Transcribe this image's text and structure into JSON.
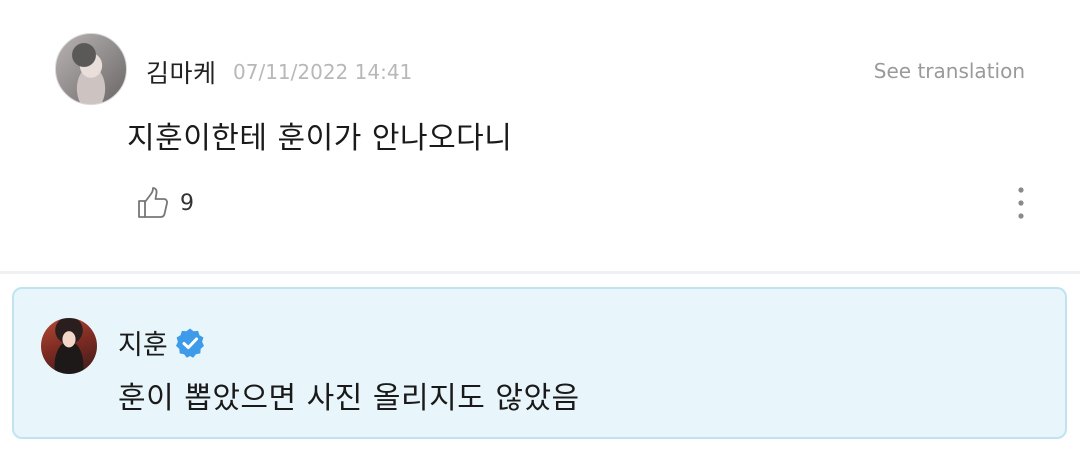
{
  "comment": {
    "author": "김마케",
    "timestamp": "07/11/2022 14:41",
    "see_translation": "See translation",
    "text": "지훈이한테 훈이가 안나오다니",
    "like_count": "9",
    "icons": {
      "like": "thumbs-up-icon",
      "more": "more-vertical-icon"
    }
  },
  "reply": {
    "author": "지훈",
    "text": "훈이 뽑았으면 사진 올리지도 않았음",
    "verified_icon": "verified-badge-icon"
  },
  "colors": {
    "reply_background": "#e8f6fb",
    "reply_border": "#bfe4f0",
    "verified_badge": "#3d9be9"
  }
}
